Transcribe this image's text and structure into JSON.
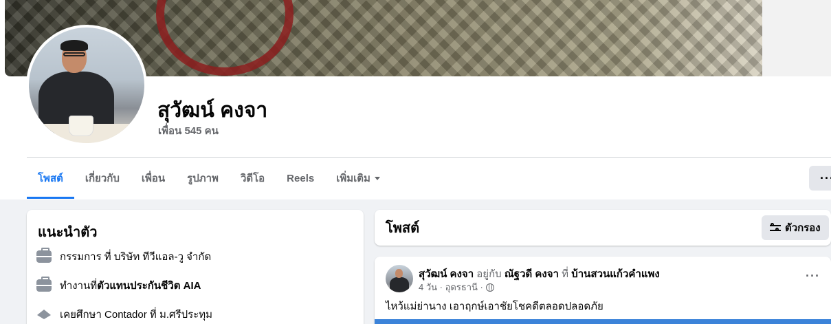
{
  "profile": {
    "name": "สุวัฒน์ คงจา",
    "friends": "เพื่อน 545 คน"
  },
  "tabs": [
    {
      "label": "โพสต์",
      "active": true
    },
    {
      "label": "เกี่ยวกับ",
      "active": false
    },
    {
      "label": "เพื่อน",
      "active": false
    },
    {
      "label": "รูปภาพ",
      "active": false
    },
    {
      "label": "วิดีโอ",
      "active": false
    },
    {
      "label": "Reels",
      "active": false
    },
    {
      "label": "เพิ่มเติม",
      "active": false
    }
  ],
  "more_button": "···",
  "intro": {
    "title": "แนะนำตัว",
    "items": [
      {
        "icon": "briefcase-icon",
        "prefix": "กรรมการ ที่ บริษัท ทีวีแอล-วู จำกัด",
        "bold": ""
      },
      {
        "icon": "briefcase-icon",
        "prefix": "ทำงานที่ ",
        "bold": "ตัวแทนประกันชีวิต AIA"
      },
      {
        "icon": "graduation-cap-icon",
        "prefix": "เคยศึกษา Contador ที่ ม.ศรีประทุม",
        "bold": ""
      }
    ]
  },
  "posts_header": {
    "title": "โพสต์",
    "filter_label": "ตัวกรอง"
  },
  "post": {
    "author": "สุวัฒน์ คงจา",
    "with_text": " อยู่กับ ",
    "with_name": "ณัฐวดี คงจา",
    "at_text": " ที่ ",
    "place": "บ้านสวนแก้วคำแพง",
    "time": "4 วัน · อุดรธานี ·",
    "dots": "···",
    "text": "ไหว้แม่ย่านาง เอาฤกษ์เอาชัยโชคดีตลอดปลอดภัย"
  },
  "colors": {
    "accent": "#1877f2",
    "muted": "#65676b",
    "background": "#f0f2f5"
  }
}
